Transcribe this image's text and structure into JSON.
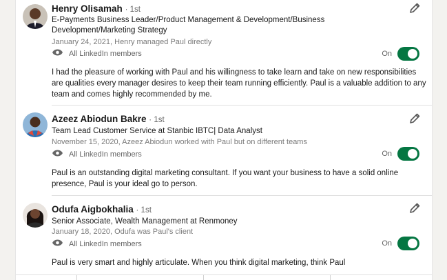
{
  "recommendations": [
    {
      "name": "Henry Olisamah",
      "degree": "· 1st",
      "headline": "E-Payments Business Leader/Product Management & Development/Business Development/Marketing Strategy",
      "meta": "January 24, 2021, Henry managed Paul directly",
      "visibility": "All LinkedIn members",
      "toggle_state": "On",
      "text": "I had the pleasure of working with Paul and his willingness to take learn and take on new responsibilities are qualities every manager desires to keep their team running efficiently. Paul is a valuable addition to any team and comes highly recommended by me."
    },
    {
      "name": "Azeez Abiodun Bakre",
      "degree": "· 1st",
      "headline": "Team Lead Customer Service at Stanbic IBTC| Data Analyst",
      "meta": "November 15, 2020, Azeez Abiodun worked with Paul but on different teams",
      "visibility": "All LinkedIn members",
      "toggle_state": "On",
      "text": "Paul is an outstanding digital marketing consultant. If you want your business to have a solid online presence, Paul is your ideal go to person."
    },
    {
      "name": "Odufa Aigbokhalia",
      "degree": "· 1st",
      "headline": "Senior Associate, Wealth Management at Renmoney",
      "meta": "January 18, 2020, Odufa was Paul's client",
      "visibility": "All LinkedIn members",
      "toggle_state": "On",
      "text": "Paul is very smart and highly articulate. When you think digital marketing, think Paul"
    }
  ],
  "icons": {
    "edit": "pencil-icon",
    "visibility": "eye-icon"
  },
  "colors": {
    "toggle_on": "#057642"
  }
}
